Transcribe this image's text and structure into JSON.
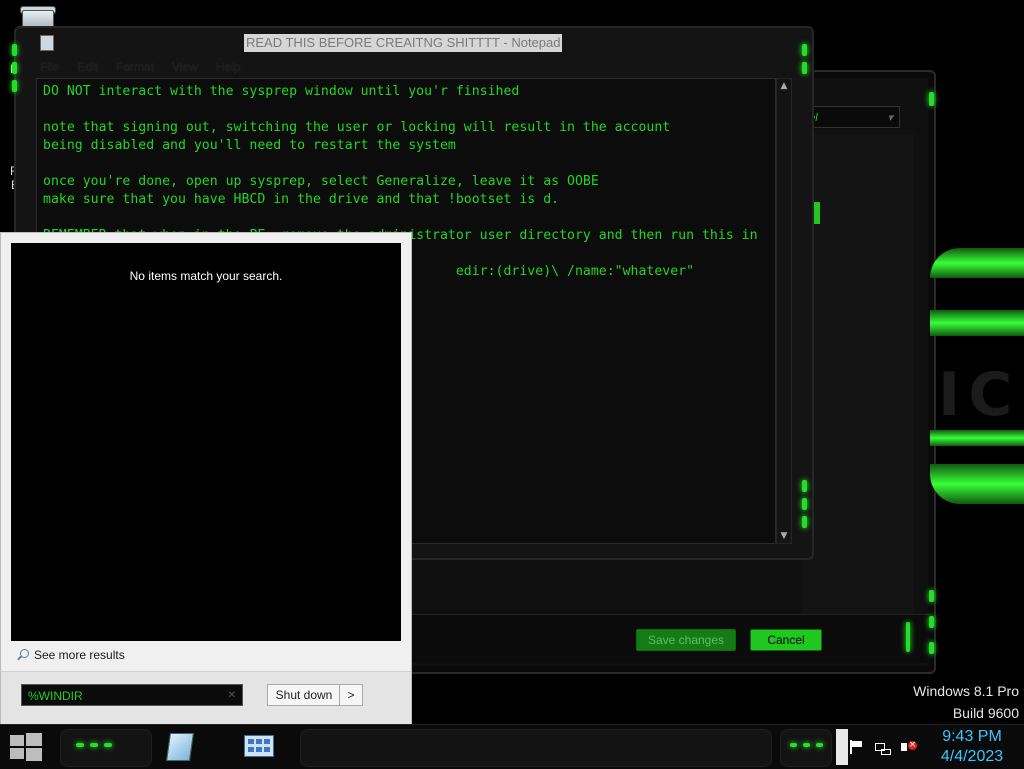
{
  "desktop": {
    "icons": [
      {
        "name": "recycle-bin",
        "icon": "recycle-bin-icon"
      }
    ],
    "edge_letters": [
      "R",
      "E"
    ]
  },
  "notepad": {
    "title": "READ THIS BEFORE CREAITNG SHITTTT - Notepad",
    "menu": [
      "File",
      "Edit",
      "Format",
      "View",
      "Help"
    ],
    "text_lines": [
      "DO NOT interact with the sysprep window until you'r finsihed",
      "",
      "note that signing out, switching the user or locking will result in the account",
      "being disabled and you'll need to restart the system",
      "",
      "once you're done, open up sysprep, select Generalize, leave it as OOBE",
      "make sure that you have HBCD in the drive and that !bootset is d.",
      "",
      "REMEMBER that when in the PE, remove the administrator user directory and then run this in",
      "",
      "                                                    edir:(drive)\\ /name:\"whatever\""
    ]
  },
  "control_panel": {
    "combo_value": "nel",
    "buttons": {
      "save": "Save changes",
      "cancel": "Cancel"
    }
  },
  "start_search": {
    "no_results": "No items match your search.",
    "see_more": "See more results",
    "query": "%WINDIR",
    "shutdown": "Shut down",
    "shutdown_arrow": ">"
  },
  "watermark": {
    "line1": "Windows 8.1 Pro",
    "line2": "Build 9600"
  },
  "taskbar": {
    "pinned": [
      {
        "name": "notepad",
        "icon": "notepad-icon"
      },
      {
        "name": "control-panel",
        "icon": "control-panel-icon"
      }
    ],
    "tray_icons": [
      "action-center-flag-icon",
      "network-icon",
      "volume-muted-icon"
    ],
    "clock": {
      "time": "9:43 PM",
      "date": "4/4/2023"
    }
  },
  "colors": {
    "accent_green": "#22d622",
    "clock_blue": "#36c8ff"
  }
}
